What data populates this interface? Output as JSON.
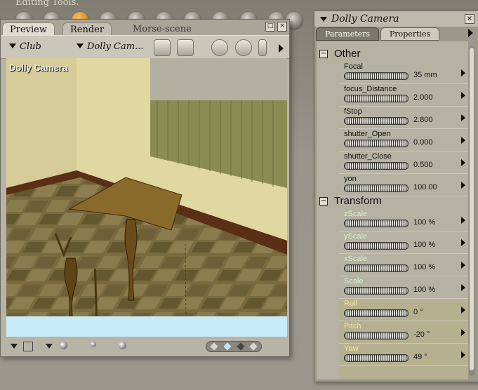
{
  "app": {
    "top_caption": "Editing Tools."
  },
  "preview": {
    "tabs": [
      {
        "label": "Preview"
      },
      {
        "label": "Render"
      },
      {
        "label": "Morse-scene"
      }
    ],
    "figure_dropdown": "Club",
    "camera_dropdown": "Dolly Cam...",
    "viewport_label": "Dolly Camera"
  },
  "parameters_panel": {
    "title": "Dolly Camera",
    "tabs": [
      {
        "label": "Parameters"
      },
      {
        "label": "Properties"
      }
    ],
    "groups": [
      {
        "name": "Other",
        "params": [
          {
            "name": "Focal",
            "value": "35 mm"
          },
          {
            "name": "focus_Distance",
            "value": "2.000"
          },
          {
            "name": "fStop",
            "value": "2.800"
          },
          {
            "name": "shutter_Open",
            "value": "0.000"
          },
          {
            "name": "shutter_Close",
            "value": "0.500"
          },
          {
            "name": "yon",
            "value": "100.00"
          }
        ]
      },
      {
        "name": "Transform",
        "params": [
          {
            "name": "zScale",
            "value": "100 %"
          },
          {
            "name": "yScale",
            "value": "100 %"
          },
          {
            "name": "xScale",
            "value": "100 %"
          },
          {
            "name": "Scale",
            "value": "100 %"
          },
          {
            "name": "Roll",
            "value": "0 °"
          },
          {
            "name": "Pitch",
            "value": "-20 °"
          },
          {
            "name": "Yaw",
            "value": "49 °"
          }
        ]
      }
    ]
  },
  "colors": {
    "scale_label": "#d6f1c9",
    "rotation_label": "#efe79e",
    "viewport_strip": "#c7ecf7"
  }
}
